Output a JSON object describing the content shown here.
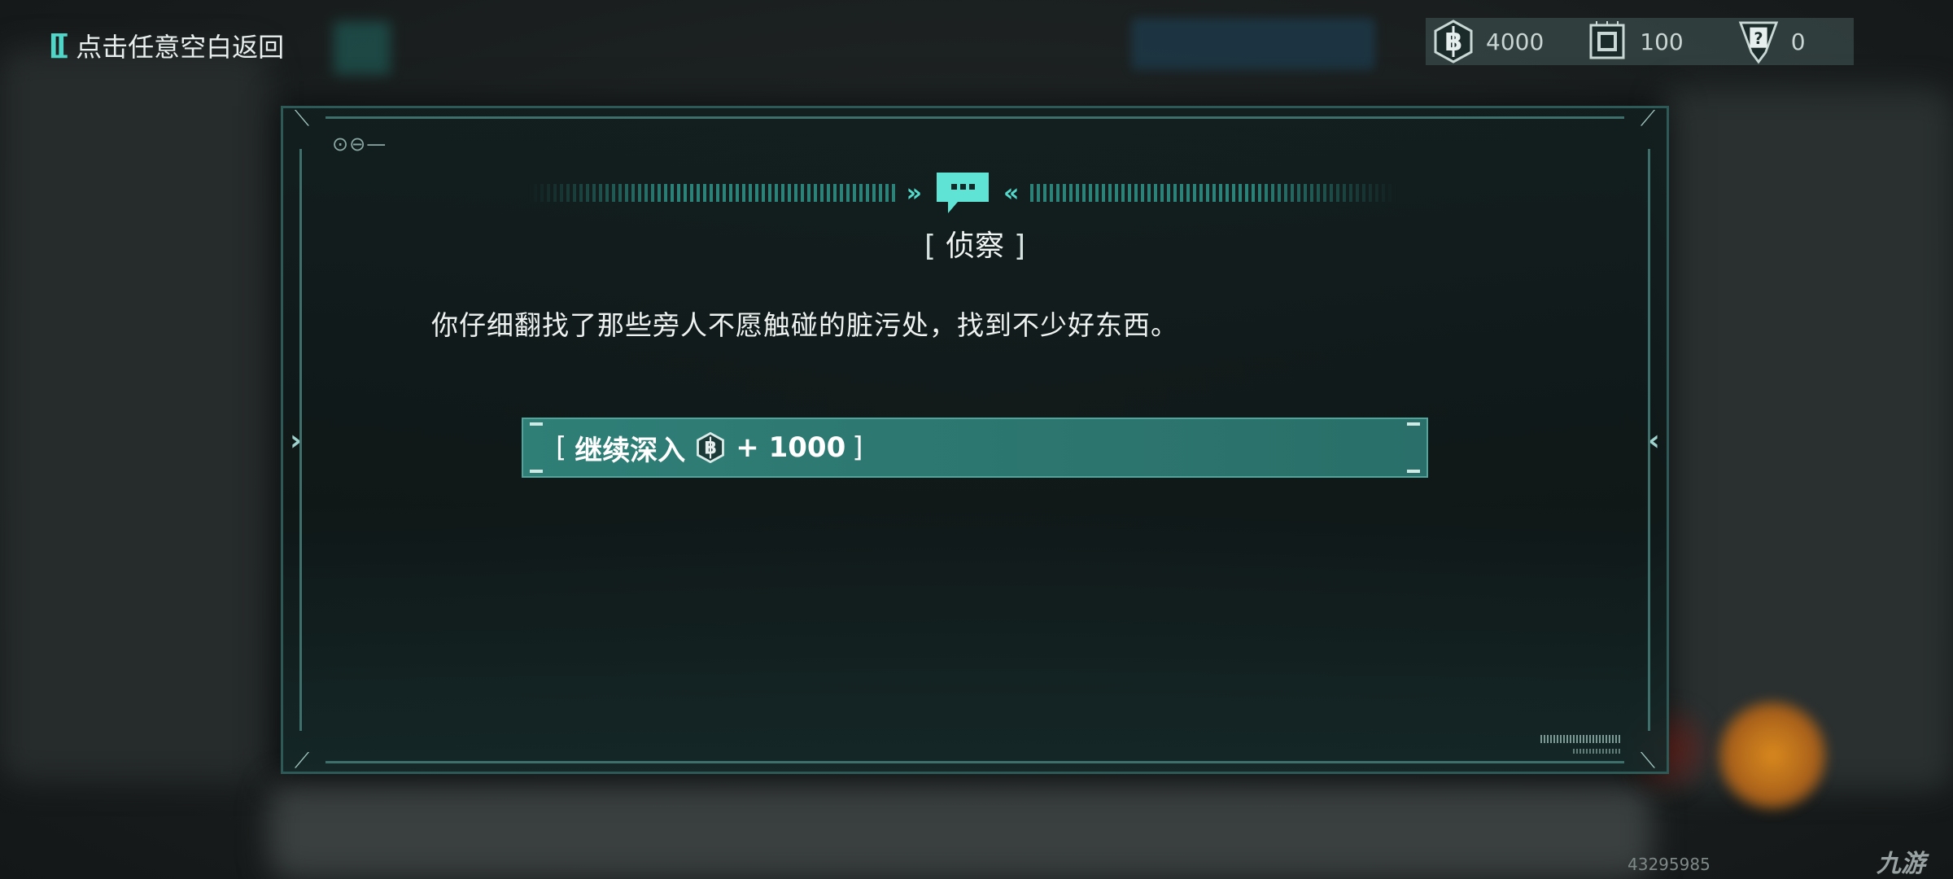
{
  "header": {
    "back_icon": "[[",
    "back_label": "点击任意空白返回"
  },
  "resources": [
    {
      "icon": "coin-icon",
      "value": "4000"
    },
    {
      "icon": "chip-icon",
      "value": "100"
    },
    {
      "icon": "mystery-card-icon",
      "value": "0"
    }
  ],
  "dialog": {
    "id_marker": "⊙⊖—",
    "chat_icon": "speech-bubble-icon",
    "title": "侦察",
    "title_left_bracket": "[",
    "title_right_bracket": "]",
    "body": "你仔细翻找了那些旁人不愿触碰的脏污处，找到不少好东西。",
    "choice": {
      "left_bracket": "[",
      "label": "继续深入",
      "reward_icon": "coin-icon",
      "reward": "+ 1000",
      "right_bracket": "]"
    }
  },
  "footer": {
    "uid": "43295985",
    "watermark": "九游"
  },
  "colors": {
    "accent": "#4fd6c8",
    "choice_bg": "#2f7f77",
    "panel_bg": "#121e1e"
  }
}
